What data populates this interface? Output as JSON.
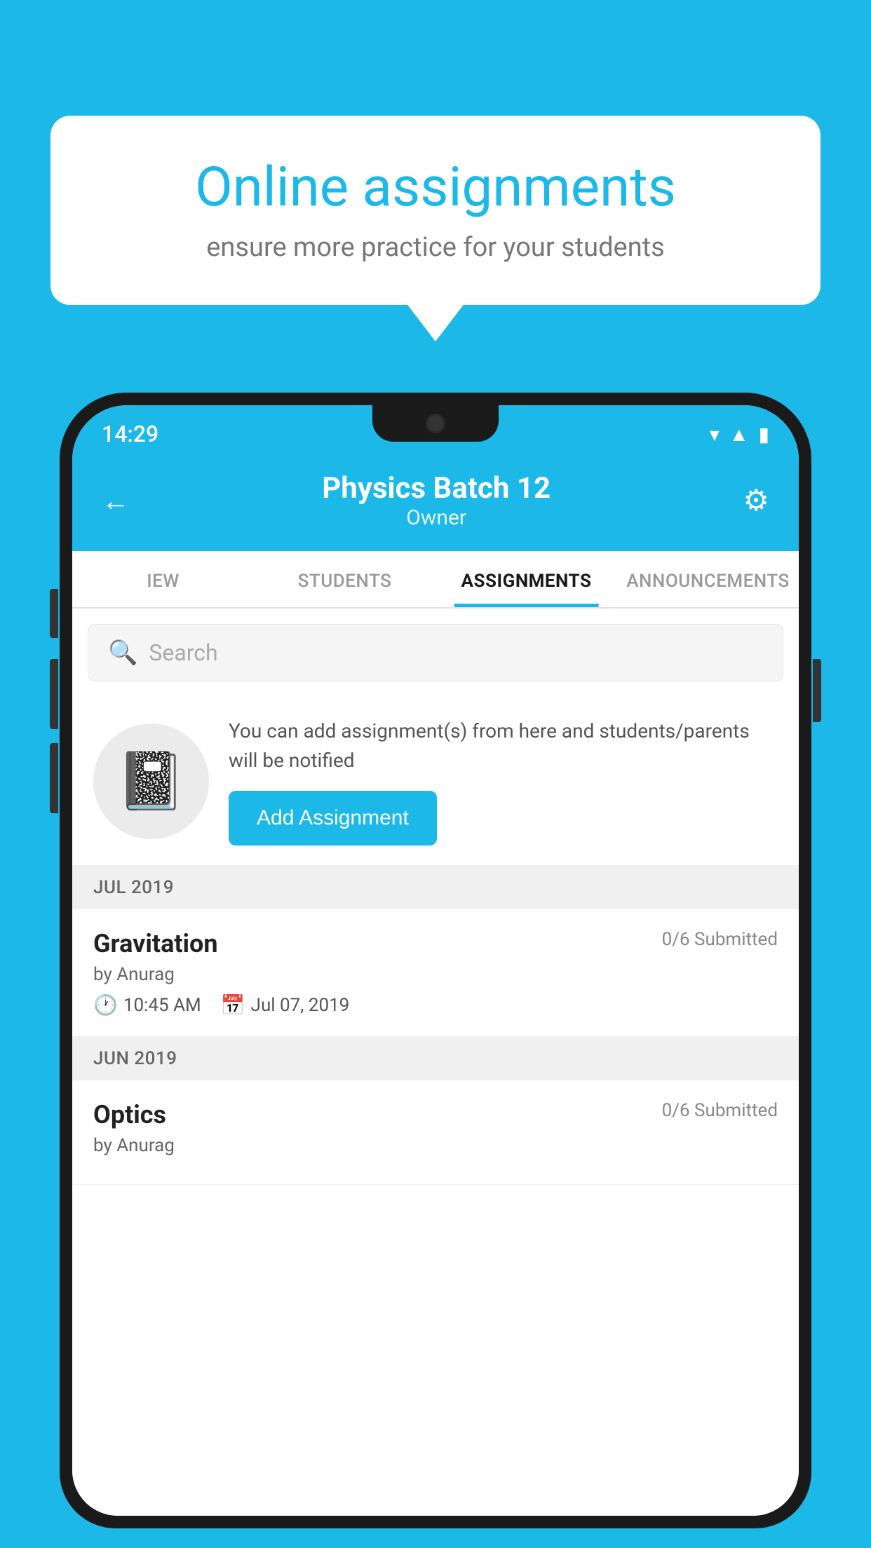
{
  "background_color": "#1bb8e8",
  "speech_bubble": {
    "title": "Online assignments",
    "subtitle": "ensure more practice for your students"
  },
  "status_bar": {
    "time": "14:29",
    "icons": [
      "wifi",
      "signal",
      "battery"
    ]
  },
  "header": {
    "title": "Physics Batch 12",
    "subtitle": "Owner",
    "back_label": "←",
    "settings_label": "⚙"
  },
  "tabs": [
    {
      "label": "IEW",
      "active": false
    },
    {
      "label": "STUDENTS",
      "active": false
    },
    {
      "label": "ASSIGNMENTS",
      "active": true
    },
    {
      "label": "ANNOUNCEMENTS",
      "active": false
    }
  ],
  "search": {
    "placeholder": "Search"
  },
  "promo": {
    "text": "You can add assignment(s) from here and students/parents will be notified",
    "button_label": "Add Assignment"
  },
  "assignment_groups": [
    {
      "month": "JUL 2019",
      "assignments": [
        {
          "name": "Gravitation",
          "submitted": "0/6 Submitted",
          "by": "by Anurag",
          "time": "10:45 AM",
          "date": "Jul 07, 2019"
        }
      ]
    },
    {
      "month": "JUN 2019",
      "assignments": [
        {
          "name": "Optics",
          "submitted": "0/6 Submitted",
          "by": "by Anurag",
          "time": "",
          "date": ""
        }
      ]
    }
  ]
}
